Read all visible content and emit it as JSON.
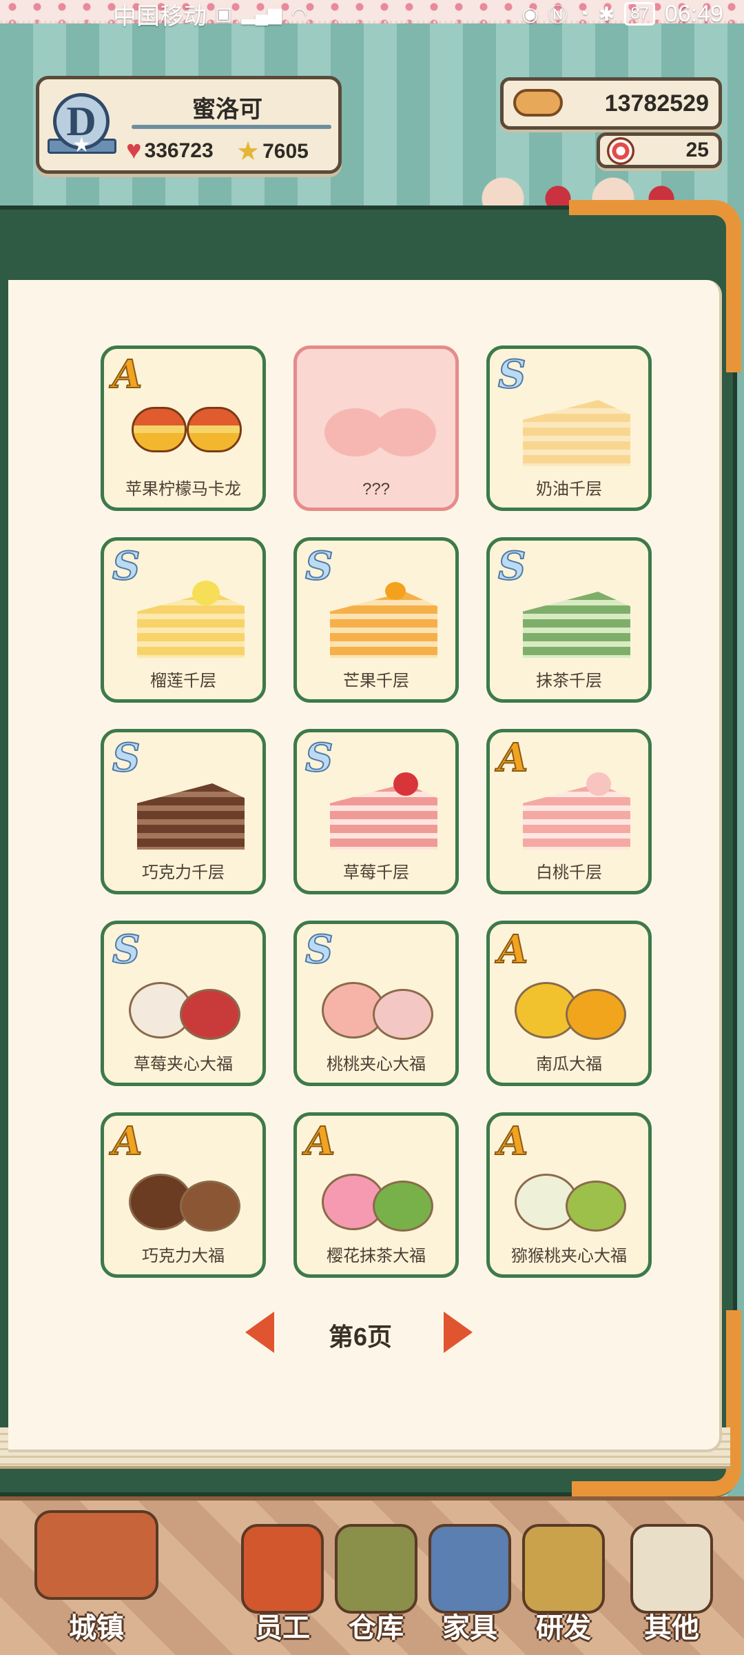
{
  "status_bar": {
    "carrier": "中国移动",
    "icons": [
      "hd-icon",
      "5g-signal-icon",
      "wifi-icon"
    ],
    "right_icons": [
      "eye-icon",
      "nfc-icon",
      "alarm-icon",
      "bluetooth-icon"
    ],
    "battery": "87",
    "time": "06:49"
  },
  "player": {
    "rank": "D",
    "name": "蜜洛可",
    "exp_progress": 1.0,
    "hearts": "336723",
    "stars": "7605"
  },
  "currency": {
    "coins": "13782529",
    "candy": "25"
  },
  "recipes": [
    {
      "rank": "A",
      "name": "苹果柠檬马卡龙",
      "art": "macaron",
      "locked": false
    },
    {
      "rank": "",
      "name": "???",
      "art": "locked",
      "locked": true
    },
    {
      "rank": "S",
      "name": "奶油千层",
      "art": "crepe-cream",
      "locked": false
    },
    {
      "rank": "S",
      "name": "榴莲千层",
      "art": "crepe-durian",
      "locked": false
    },
    {
      "rank": "S",
      "name": "芒果千层",
      "art": "crepe-mango",
      "locked": false
    },
    {
      "rank": "S",
      "name": "抹茶千层",
      "art": "crepe-matcha",
      "locked": false
    },
    {
      "rank": "S",
      "name": "巧克力千层",
      "art": "crepe-chocolate",
      "locked": false
    },
    {
      "rank": "S",
      "name": "草莓千层",
      "art": "crepe-strawberry",
      "locked": false
    },
    {
      "rank": "A",
      "name": "白桃千层",
      "art": "crepe-peach",
      "locked": false
    },
    {
      "rank": "S",
      "name": "草莓夹心大福",
      "art": "daifuku-strawberry",
      "locked": false
    },
    {
      "rank": "S",
      "name": "桃桃夹心大福",
      "art": "daifuku-peach",
      "locked": false
    },
    {
      "rank": "A",
      "name": "南瓜大福",
      "art": "daifuku-pumpkin",
      "locked": false
    },
    {
      "rank": "A",
      "name": "巧克力大福",
      "art": "daifuku-chocolate",
      "locked": false
    },
    {
      "rank": "A",
      "name": "樱花抹茶大福",
      "art": "daifuku-sakura",
      "locked": false
    },
    {
      "rank": "A",
      "name": "猕猴桃夹心大福",
      "art": "daifuku-kiwi",
      "locked": false
    }
  ],
  "pager": {
    "label": "第6页"
  },
  "nav": [
    {
      "id": "town",
      "label": "城镇",
      "icon": "town-house-icon",
      "color": "#c8643a"
    },
    {
      "id": "staff",
      "label": "员工",
      "icon": "apron-icon",
      "color": "#d2572d"
    },
    {
      "id": "storage",
      "label": "仓库",
      "icon": "backpack-icon",
      "color": "#8a8f4a"
    },
    {
      "id": "furniture",
      "label": "家具",
      "icon": "paint-bucket-icon",
      "color": "#5a7fb0"
    },
    {
      "id": "research",
      "label": "研发",
      "icon": "mortar-icon",
      "color": "#c9a24b"
    },
    {
      "id": "other",
      "label": "其他",
      "icon": "menu-grid-icon",
      "color": "#e9dfc9"
    }
  ],
  "colors": {
    "card_border": "#3d7a4a",
    "card_bg": "#fdf3d8",
    "locked_bg": "#fbd7d2",
    "rank_A": "#f1a321",
    "rank_S": "#bcdaf2",
    "arrow": "#e0552f"
  }
}
